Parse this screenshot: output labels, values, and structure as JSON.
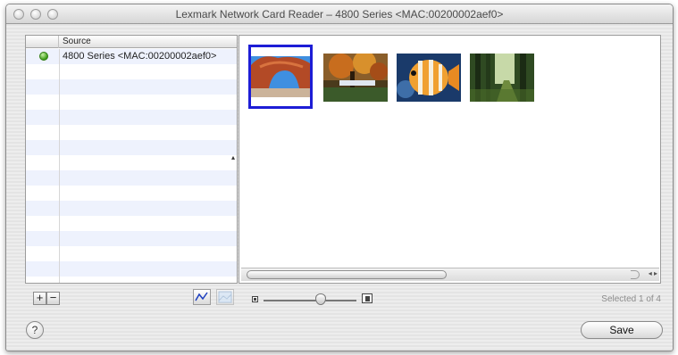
{
  "window": {
    "title": "Lexmark Network Card Reader – 4800 Series <MAC:00200002aef0>"
  },
  "source_table": {
    "header": "Source",
    "rows": [
      {
        "label": "4800 Series <MAC:00200002aef0>",
        "status": "connected",
        "status_color": "#3c9b18"
      }
    ]
  },
  "image_browser": {
    "thumbnails": [
      {
        "name": "arch-photo",
        "selected": true
      },
      {
        "name": "autumn-tree-photo",
        "selected": false
      },
      {
        "name": "tropical-fish-photo",
        "selected": false
      },
      {
        "name": "forest-path-photo",
        "selected": false
      }
    ],
    "scroll_arrows": "◂ ▸"
  },
  "controls": {
    "add_label": "+",
    "remove_label": "−",
    "help_label": "?",
    "save_label": "Save",
    "selected_status": "Selected 1 of 4",
    "zoom_level": 0.62
  },
  "colors": {
    "selection_border": "#1d1dd6",
    "row_stripe": "#eef2fd"
  }
}
